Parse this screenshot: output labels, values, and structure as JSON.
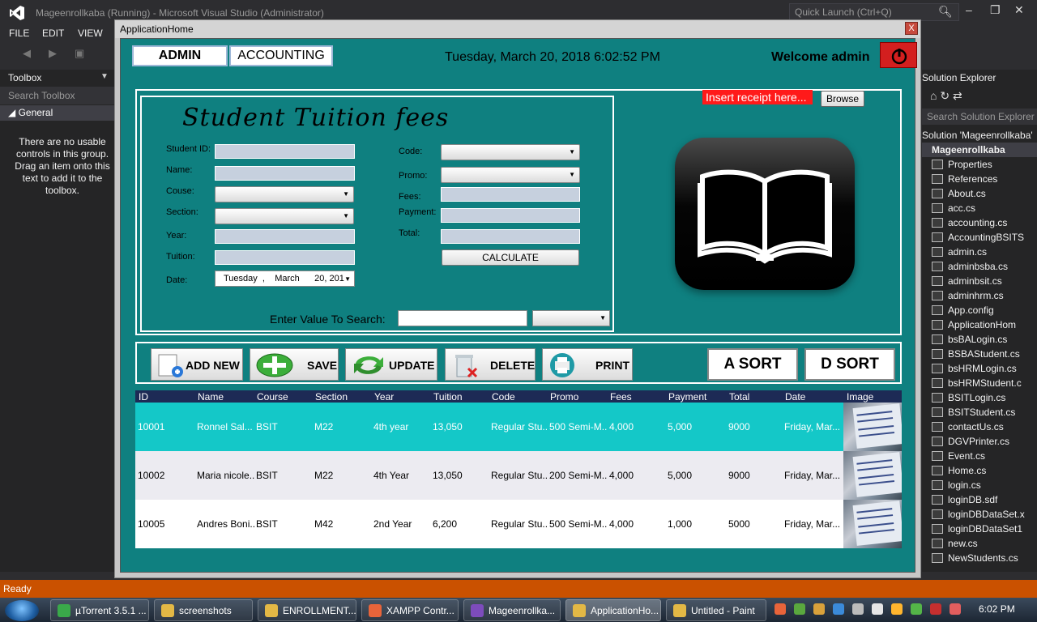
{
  "vs": {
    "title": "Mageenrollkaba (Running) - Microsoft Visual Studio (Administrator)",
    "quick_launch": "Quick Launch (Ctrl+Q)",
    "menu": [
      "FILE",
      "EDIT",
      "VIEW"
    ],
    "status": "Ready"
  },
  "toolbox": {
    "title": "Toolbox",
    "search_placeholder": "Search Toolbox",
    "group": "General",
    "message": "There are no usable controls in this group. Drag an item onto this text to add it to the toolbox."
  },
  "solution_explorer": {
    "title": "Solution Explorer",
    "search": "Search Solution Explorer (",
    "solution_line": "Solution 'Mageenrollkaba'",
    "project": "Mageenrollkaba",
    "items": [
      "Properties",
      "References",
      "About.cs",
      "acc.cs",
      "accounting.cs",
      "AccountingBSITS",
      "admin.cs",
      "adminbsba.cs",
      "adminbsit.cs",
      "adminhrm.cs",
      "App.config",
      "ApplicationHom",
      "bsBALogin.cs",
      "BSBAStudent.cs",
      "bsHRMLogin.cs",
      "bsHRMStudent.c",
      "BSITLogin.cs",
      "BSITStudent.cs",
      "contactUs.cs",
      "DGVPrinter.cs",
      "Event.cs",
      "Home.cs",
      "login.cs",
      "loginDB.sdf",
      "loginDBDataSet.x",
      "loginDBDataSet1",
      "new.cs",
      "NewStudents.cs"
    ]
  },
  "app": {
    "window_title": "ApplicationHome",
    "close_label": "X",
    "tab_admin": "ADMIN",
    "tab_accounting": "ACCOUNTING",
    "datetime": "Tuesday, March 20, 2018  6:02:52 PM",
    "welcome": "Welcome  admin",
    "form_title": "Student Tuition fees",
    "labels": {
      "student_id": "Student ID:",
      "name": "Name:",
      "course": "Couse:",
      "section": "Section:",
      "year": "Year:",
      "tuition": "Tuition:",
      "date": "Date:",
      "code": "Code:",
      "promo": "Promo:",
      "fees": "Fees:",
      "payment": "Payment:",
      "total": "Total:"
    },
    "date_value": {
      "day": "Tuesday",
      "sep": ",",
      "month": "March",
      "date": "20, 201"
    },
    "calculate": "CALCULATE",
    "search_label": "Enter Value To Search:",
    "receipt_label": "Insert receipt here...",
    "browse": "Browse",
    "buttons": {
      "add": "ADD NEW",
      "save": "SAVE",
      "update": "UPDATE",
      "delete": "DELETE",
      "print": "PRINT",
      "asort": "A SORT",
      "dsort": "D SORT"
    },
    "grid": {
      "columns": [
        "ID",
        "Name",
        "Course",
        "Section",
        "Year",
        "Tuition",
        "Code",
        "Promo",
        "Fees",
        "Payment",
        "Total",
        "Date",
        "Image"
      ],
      "rows": [
        {
          "id": "10001",
          "name": "Ronnel Sal...",
          "course": "BSIT",
          "section": "M22",
          "year": "4th year",
          "tuition": "13,050",
          "code": "Regular Stu...",
          "promo": "500 Semi-M...",
          "fees": "4,000",
          "payment": "5,000",
          "total": "9000",
          "date": "Friday, Mar..."
        },
        {
          "id": "10002",
          "name": "Maria nicole...",
          "course": "BSIT",
          "section": "M22",
          "year": "4th Year",
          "tuition": "13,050",
          "code": "Regular Stu...",
          "promo": "200 Semi-M...",
          "fees": "4,000",
          "payment": "5,000",
          "total": "9000",
          "date": "Friday, Mar..."
        },
        {
          "id": "10005",
          "name": "Andres Boni...",
          "course": "BSIT",
          "section": "M42",
          "year": "2nd Year",
          "tuition": "6,200",
          "code": "Regular Stu...",
          "promo": "500 Semi-M...",
          "fees": "4,000",
          "payment": "1,000",
          "total": "5000",
          "date": "Friday, Mar..."
        }
      ]
    }
  },
  "taskbar": {
    "items": [
      "µTorrent 3.5.1 ...",
      "screenshots",
      "ENROLLMENT...",
      "XAMPP Contr...",
      "Mageenrollka...",
      "ApplicationHo...",
      "Untitled - Paint"
    ],
    "clock": "6:02 PM"
  }
}
